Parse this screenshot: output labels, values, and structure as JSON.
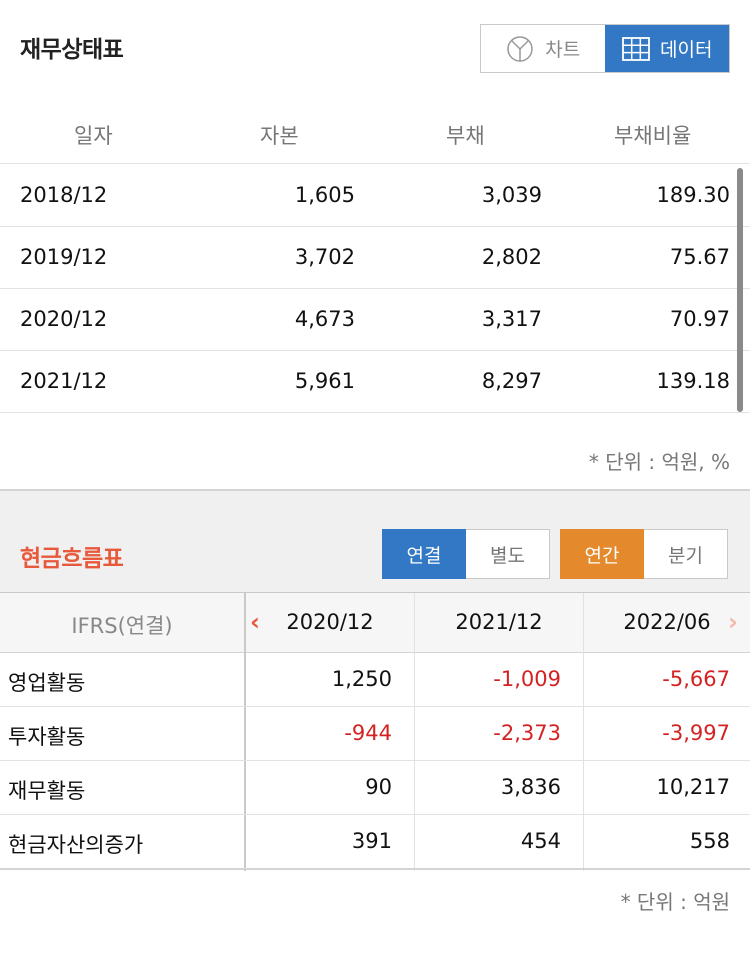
{
  "balance_sheet": {
    "title": "재무상태표",
    "toggle": {
      "chart_label": "차트",
      "data_label": "데이터",
      "active": "data"
    },
    "columns": [
      "일자",
      "자본",
      "부채",
      "부채비율"
    ],
    "rows": [
      {
        "date": "2018/12",
        "capital": "1,605",
        "debt": "3,039",
        "ratio": "189.30"
      },
      {
        "date": "2019/12",
        "capital": "3,702",
        "debt": "2,802",
        "ratio": "75.67"
      },
      {
        "date": "2020/12",
        "capital": "4,673",
        "debt": "3,317",
        "ratio": "70.97"
      },
      {
        "date": "2021/12",
        "capital": "5,961",
        "debt": "8,297",
        "ratio": "139.18"
      }
    ],
    "unit_note": "* 단위 : 억원, %"
  },
  "cash_flow": {
    "title": "현금흐름표",
    "scope_toggle": {
      "consolidated": "연결",
      "separate": "별도",
      "active": "consolidated"
    },
    "period_toggle": {
      "annual": "연간",
      "quarterly": "분기",
      "active": "annual"
    },
    "header_label": "IFRS(연결)",
    "periods": [
      "2020/12",
      "2021/12",
      "2022/06"
    ],
    "nav": {
      "prev_icon": "chevron-left-icon",
      "next_icon": "chevron-right-icon"
    },
    "rows": [
      {
        "name": "영업활동",
        "values": [
          "1,250",
          "-1,009",
          "-5,667"
        ]
      },
      {
        "name": "투자활동",
        "values": [
          "-944",
          "-2,373",
          "-3,997"
        ]
      },
      {
        "name": "재무활동",
        "values": [
          "90",
          "3,836",
          "10,217"
        ]
      },
      {
        "name": "현금자산의증가",
        "values": [
          "391",
          "454",
          "558"
        ]
      }
    ],
    "unit_note": "* 단위 : 억원"
  },
  "colors": {
    "accent_blue": "#3378c4",
    "accent_orange": "#e58a2c",
    "title_red": "#e8583b",
    "negative_red": "#d42222"
  }
}
